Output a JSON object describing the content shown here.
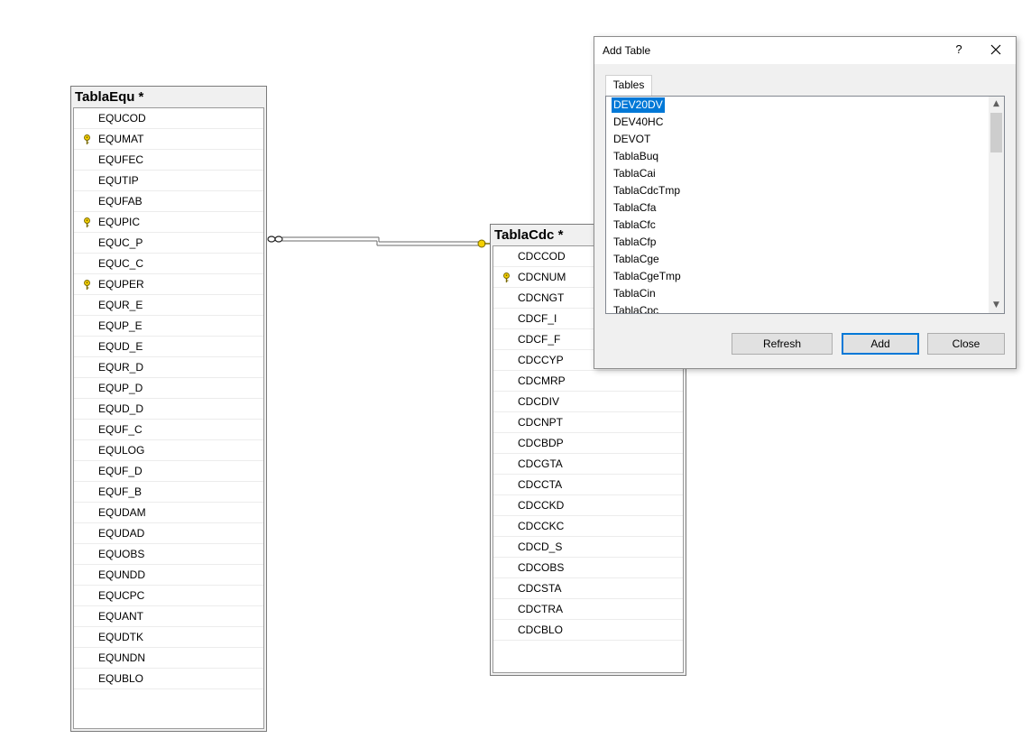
{
  "tables": {
    "equ": {
      "title": "TablaEqu *",
      "columns": [
        {
          "name": "EQUCOD",
          "key": false
        },
        {
          "name": "EQUMAT",
          "key": true
        },
        {
          "name": "EQUFEC",
          "key": false
        },
        {
          "name": "EQUTIP",
          "key": false
        },
        {
          "name": "EQUFAB",
          "key": false
        },
        {
          "name": "EQUPIC",
          "key": true
        },
        {
          "name": "EQUC_P",
          "key": false
        },
        {
          "name": "EQUC_C",
          "key": false
        },
        {
          "name": "EQUPER",
          "key": true
        },
        {
          "name": "EQUR_E",
          "key": false
        },
        {
          "name": "EQUP_E",
          "key": false
        },
        {
          "name": "EQUD_E",
          "key": false
        },
        {
          "name": "EQUR_D",
          "key": false
        },
        {
          "name": "EQUP_D",
          "key": false
        },
        {
          "name": "EQUD_D",
          "key": false
        },
        {
          "name": "EQUF_C",
          "key": false
        },
        {
          "name": "EQULOG",
          "key": false
        },
        {
          "name": "EQUF_D",
          "key": false
        },
        {
          "name": "EQUF_B",
          "key": false
        },
        {
          "name": "EQUDAM",
          "key": false
        },
        {
          "name": "EQUDAD",
          "key": false
        },
        {
          "name": "EQUOBS",
          "key": false
        },
        {
          "name": "EQUNDD",
          "key": false
        },
        {
          "name": "EQUCPC",
          "key": false
        },
        {
          "name": "EQUANT",
          "key": false
        },
        {
          "name": "EQUDTK",
          "key": false
        },
        {
          "name": "EQUNDN",
          "key": false
        },
        {
          "name": "EQUBLO",
          "key": false
        }
      ]
    },
    "cdc": {
      "title": "TablaCdc *",
      "columns": [
        {
          "name": "CDCCOD",
          "key": false
        },
        {
          "name": "CDCNUM",
          "key": true
        },
        {
          "name": "CDCNGT",
          "key": false
        },
        {
          "name": "CDCF_I",
          "key": false
        },
        {
          "name": "CDCF_F",
          "key": false
        },
        {
          "name": "CDCCYP",
          "key": false
        },
        {
          "name": "CDCMRP",
          "key": false
        },
        {
          "name": "CDCDIV",
          "key": false
        },
        {
          "name": "CDCNPT",
          "key": false
        },
        {
          "name": "CDCBDP",
          "key": false
        },
        {
          "name": "CDCGTA",
          "key": false
        },
        {
          "name": "CDCCTA",
          "key": false
        },
        {
          "name": "CDCCKD",
          "key": false
        },
        {
          "name": "CDCCKC",
          "key": false
        },
        {
          "name": "CDCD_S",
          "key": false
        },
        {
          "name": "CDCOBS",
          "key": false
        },
        {
          "name": "CDCSTA",
          "key": false
        },
        {
          "name": "CDCTRA",
          "key": false
        },
        {
          "name": "CDCBLO",
          "key": false
        }
      ]
    }
  },
  "dialog": {
    "title": "Add Table",
    "help_label": "?",
    "tab_label": "Tables",
    "items": [
      "DEV20DV",
      "DEV40HC",
      "DEVOT",
      "TablaBuq",
      "TablaCai",
      "TablaCdcTmp",
      "TablaCfa",
      "TablaCfc",
      "TablaCfp",
      "TablaCge",
      "TablaCgeTmp",
      "TablaCin",
      "TablaCpc"
    ],
    "selected_index": 0,
    "buttons": {
      "refresh": "Refresh",
      "add": "Add",
      "close": "Close"
    }
  },
  "colors": {
    "selection": "#0078d7",
    "key_icon": "#e8c000",
    "relationship_line": "#6a6a6a"
  },
  "icons": {
    "primary_key": "key-icon",
    "relationship_many": "infinity-icon",
    "relationship_one": "key-icon",
    "close": "close-icon"
  }
}
